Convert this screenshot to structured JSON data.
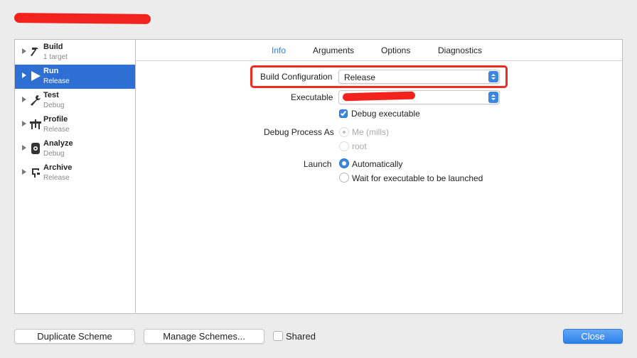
{
  "window": {
    "title_redacted": true
  },
  "sidebar": {
    "items": [
      {
        "title": "Build",
        "subtitle": "1 target",
        "icon": "hammer-icon",
        "selected": false
      },
      {
        "title": "Run",
        "subtitle": "Release",
        "icon": "play-icon",
        "selected": true
      },
      {
        "title": "Test",
        "subtitle": "Debug",
        "icon": "wrench-icon",
        "selected": false
      },
      {
        "title": "Profile",
        "subtitle": "Release",
        "icon": "gauge-icon",
        "selected": false
      },
      {
        "title": "Analyze",
        "subtitle": "Debug",
        "icon": "analyze-icon",
        "selected": false
      },
      {
        "title": "Archive",
        "subtitle": "Release",
        "icon": "archive-icon",
        "selected": false
      }
    ]
  },
  "tabs": [
    {
      "label": "Info",
      "active": true
    },
    {
      "label": "Arguments",
      "active": false
    },
    {
      "label": "Options",
      "active": false
    },
    {
      "label": "Diagnostics",
      "active": false
    }
  ],
  "info": {
    "build_configuration": {
      "label": "Build Configuration",
      "value": "Release"
    },
    "executable": {
      "label": "Executable",
      "value_redacted": true
    },
    "debug_executable": {
      "label": "Debug executable",
      "checked": true
    },
    "debug_process_as": {
      "label": "Debug Process As",
      "options": [
        "Me (mills)",
        "root"
      ],
      "selected": "Me (mills)",
      "enabled": false
    },
    "launch": {
      "label": "Launch",
      "options": [
        "Automatically",
        "Wait for executable to be launched"
      ],
      "selected": "Automatically"
    }
  },
  "footer": {
    "duplicate_label": "Duplicate Scheme",
    "manage_label": "Manage Schemes...",
    "shared_label": "Shared",
    "shared_checked": false,
    "close_label": "Close"
  },
  "colors": {
    "accent": "#2d6fd3",
    "annotation": "#ef2a1f",
    "active_tab": "#2e7bd6"
  }
}
